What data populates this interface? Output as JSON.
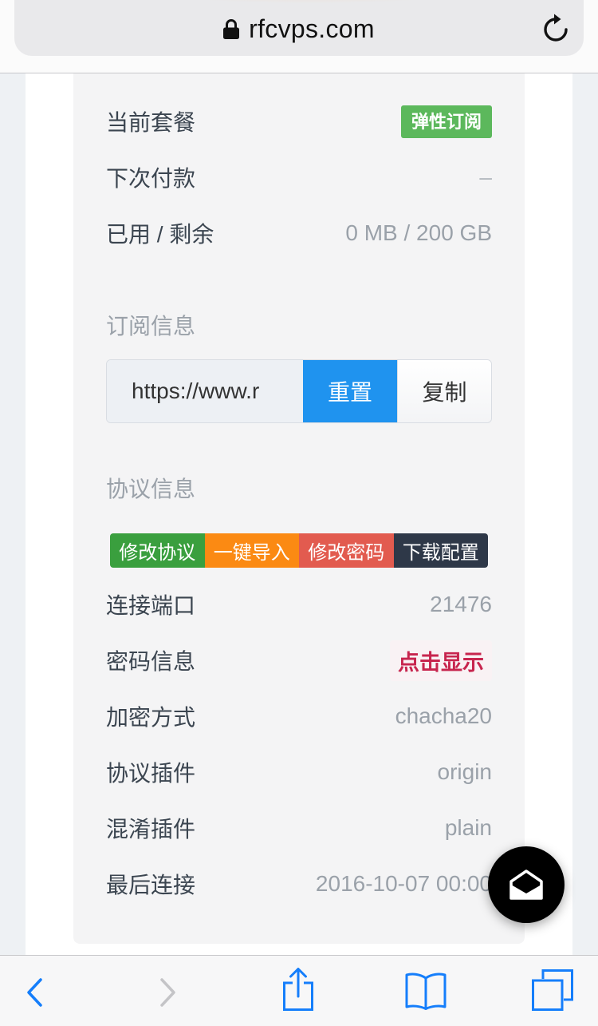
{
  "browser": {
    "url": "rfcvps.com",
    "lock_icon": "lock-icon",
    "reload_icon": "reload-icon"
  },
  "plan": {
    "current_plan_label": "当前套餐",
    "current_plan_badge": "弹性订阅",
    "next_payment_label": "下次付款",
    "next_payment_value": "–",
    "usage_label": "已用 / 剩余",
    "usage_value": "0 MB / 200 GB"
  },
  "subscription": {
    "heading": "订阅信息",
    "url_value": "https://www.r",
    "reset_label": "重置",
    "copy_label": "复制"
  },
  "protocol": {
    "heading": "协议信息",
    "actions": [
      {
        "label": "修改协议",
        "color": "#3a9f3e"
      },
      {
        "label": "一键导入",
        "color": "#fb8a13"
      },
      {
        "label": "修改密码",
        "color": "#e25b4f"
      },
      {
        "label": "下载配置",
        "color": "#2e3848"
      }
    ],
    "details": [
      {
        "label": "连接端口",
        "value": "21476"
      },
      {
        "label": "密码信息",
        "value": "点击显示"
      },
      {
        "label": "加密方式",
        "value": "chacha20"
      },
      {
        "label": "协议插件",
        "value": "origin"
      },
      {
        "label": "混淆插件",
        "value": "plain"
      },
      {
        "label": "最后连接",
        "value": "2016-10-07 00:00"
      }
    ]
  },
  "fab": {
    "icon": "mail-open-icon"
  },
  "toolbar": {
    "back_icon": "chevron-left-icon",
    "forward_icon": "chevron-right-icon",
    "share_icon": "share-icon",
    "bookmarks_icon": "book-icon",
    "tabs_icon": "tabs-icon"
  },
  "colors": {
    "badge": "#5cb85c",
    "primary": "#1f93ef",
    "chip_text": "#c7254e",
    "chip_bg": "#f9f2f4",
    "ios_blue": "#157efb"
  }
}
